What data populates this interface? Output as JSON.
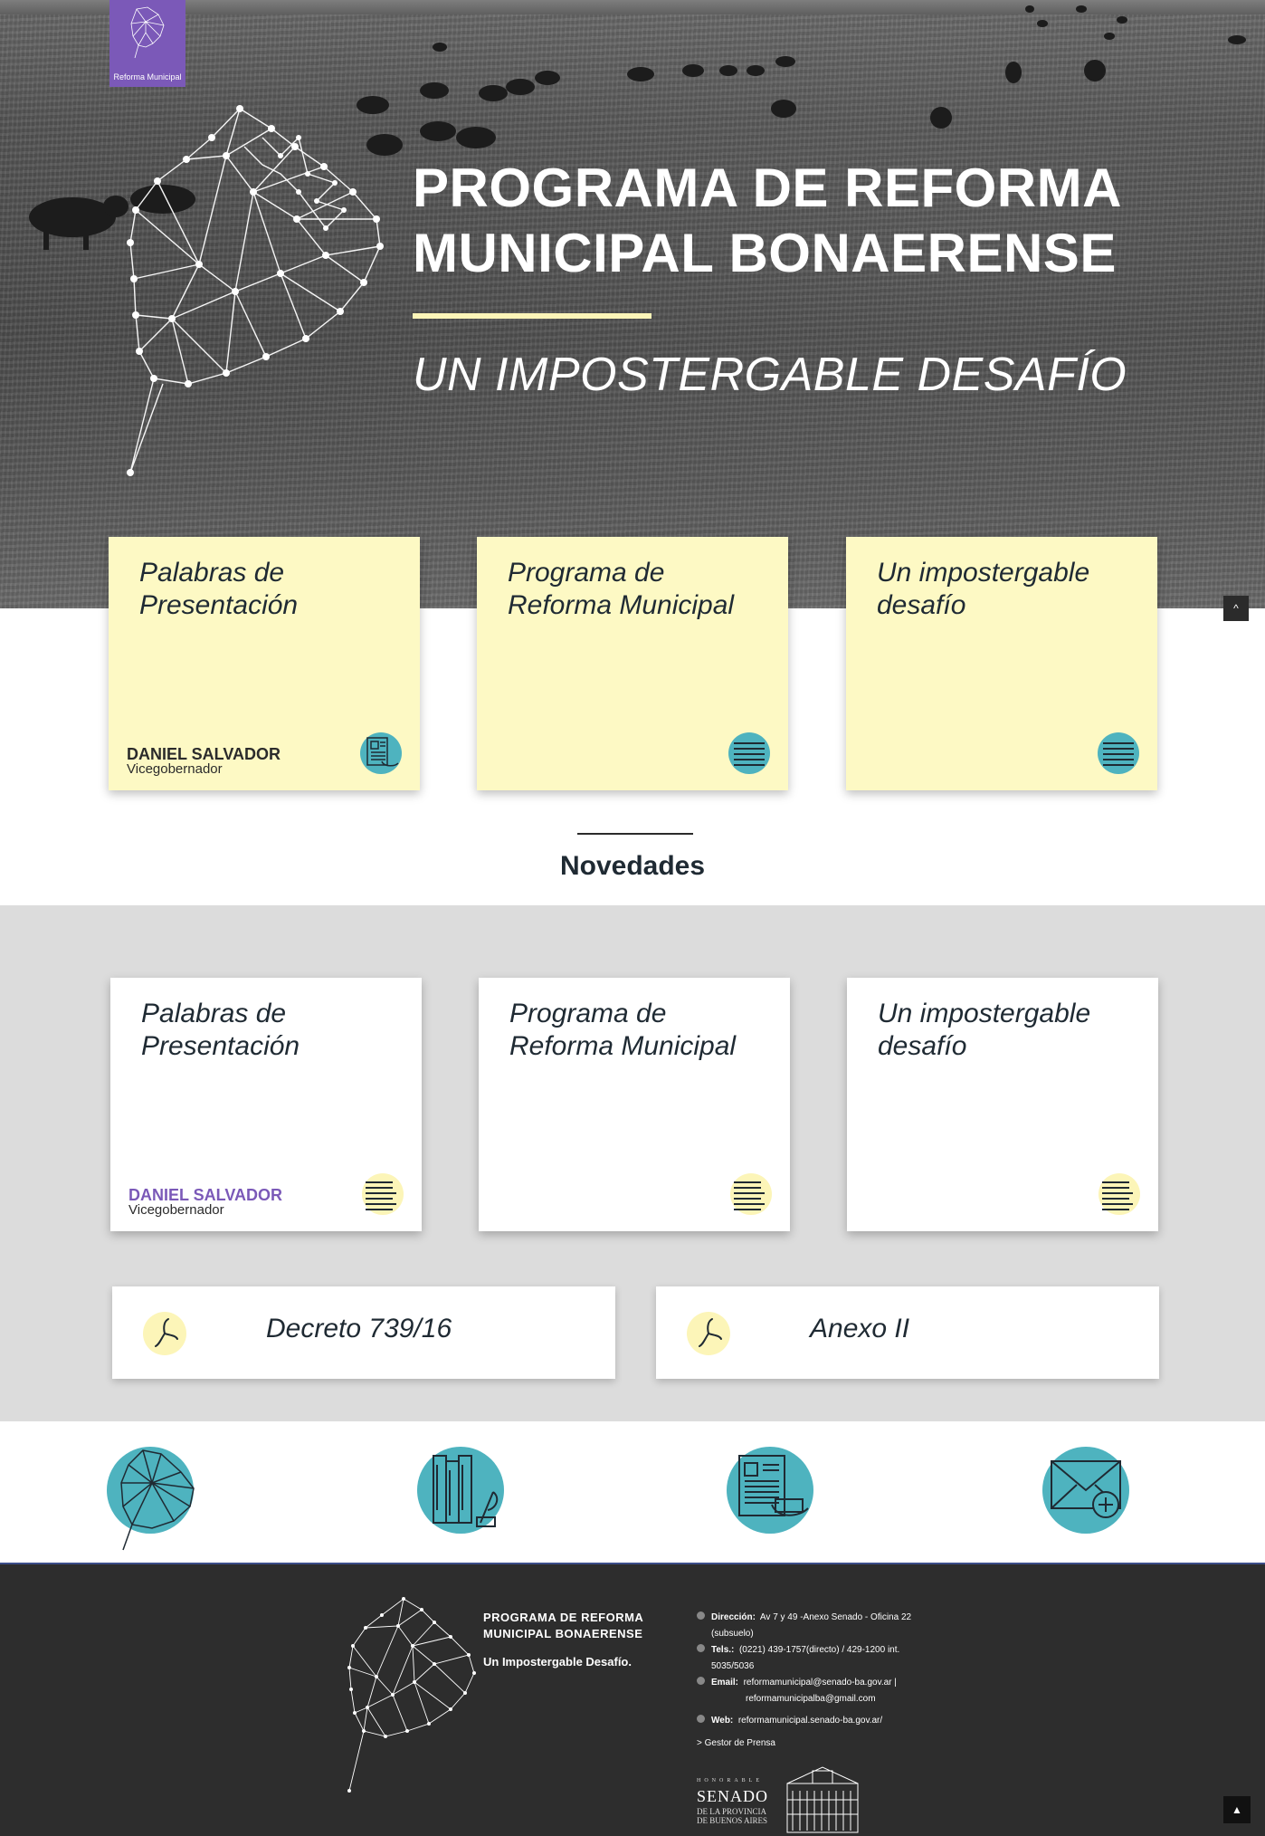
{
  "brand": {
    "badge_label": "Reforma Municipal",
    "accent_purple": "#7b59b8",
    "accent_yellow": "#fcf5b8",
    "accent_teal": "#4eb3bf"
  },
  "hero": {
    "title_line1": "PROGRAMA DE REFORMA",
    "title_line2": "MUNICIPAL BONAERENSE",
    "subtitle": "UN IMPOSTERGABLE DESAFÍO"
  },
  "top_cards": [
    {
      "title": "Palabras de Presentación",
      "author_name": "DANIEL SALVADOR",
      "author_role": "Vicegobernador",
      "icon": "document-icon"
    },
    {
      "title": "Programa de Reforma Municipal",
      "icon": "lines-icon"
    },
    {
      "title": "Un impostergable desafío",
      "icon": "lines-icon"
    }
  ],
  "news": {
    "heading": "Novedades",
    "cards": [
      {
        "title": "Palabras de Presentación",
        "author_name": "DANIEL SALVADOR",
        "author_role": "Vicegobernador",
        "icon": "lines-icon"
      },
      {
        "title": "Programa de Reforma Municipal",
        "icon": "lines-icon"
      },
      {
        "title": "Un impostergable desafío",
        "icon": "lines-icon"
      }
    ],
    "documents": [
      {
        "label": "Decreto 739/16",
        "icon": "propeller-icon"
      },
      {
        "label": "Anexo II",
        "icon": "propeller-icon"
      }
    ]
  },
  "features": [
    {
      "icon": "province-map-icon"
    },
    {
      "icon": "books-icon"
    },
    {
      "icon": "newspaper-icon"
    },
    {
      "icon": "mail-add-icon"
    }
  ],
  "footer": {
    "brand_line1": "PROGRAMA DE REFORMA",
    "brand_line2": "MUNICIPAL BONAERENSE",
    "tagline": "Un Impostergable Desafío.",
    "address_label": "Dirección:",
    "address_value": "Av 7 y 49 -Anexo Senado - Oficina 22 (subsuelo)",
    "phone_label": "Tels.:",
    "phone_value": "(0221) 439-1757(directo) / 429-1200 int. 5035/5036",
    "email_label": "Email:",
    "email_value_1": "reformamunicipal@senado-ba.gov.ar |",
    "email_value_2": "reformamunicipalba@gmail.com",
    "web_label": "Web:",
    "web_value": "reformamunicipal.senado-ba.gov.ar/",
    "press_link": "> Gestor de Prensa",
    "senado_honorable": "HONORABLE",
    "senado_name": "SENADO",
    "senado_province_1": "DE LA PROVINCIA",
    "senado_province_2": "DE BUENOS AIRES"
  }
}
